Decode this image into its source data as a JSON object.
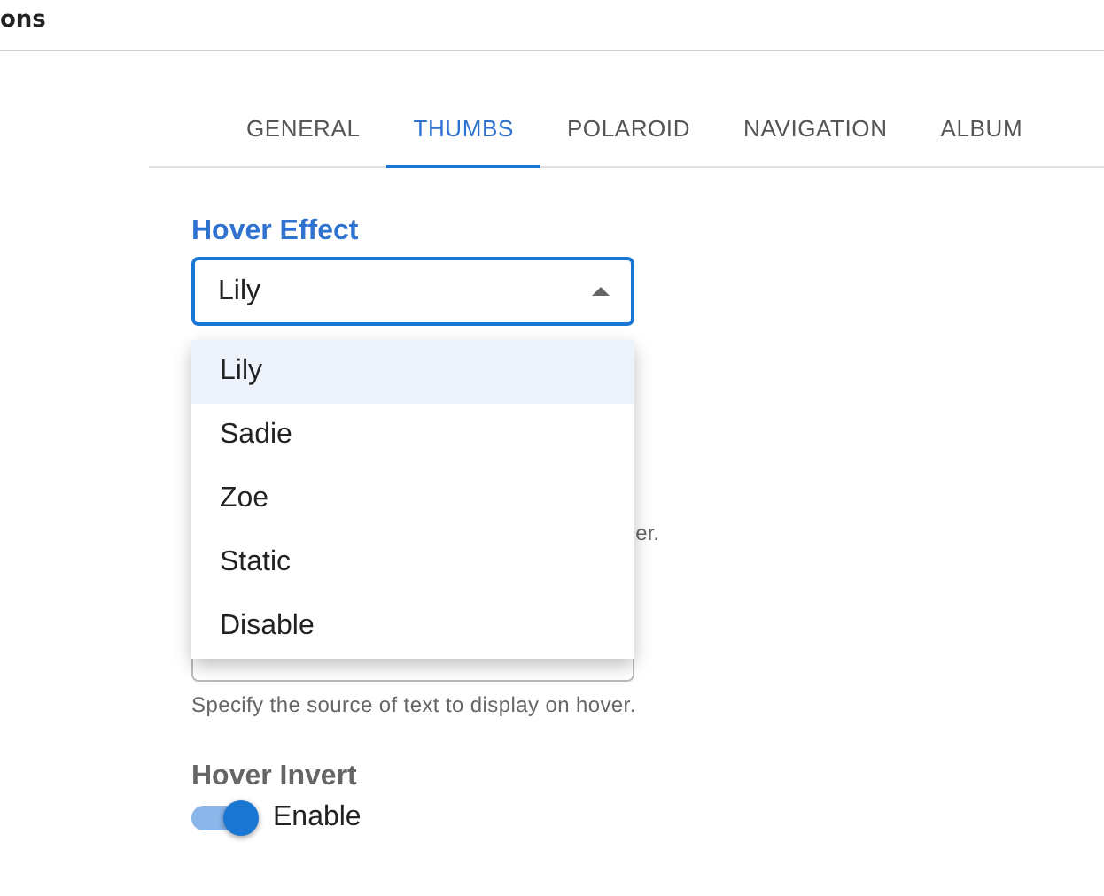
{
  "header": {
    "title": "ons"
  },
  "tabs": [
    {
      "label": "GENERAL",
      "selected": false
    },
    {
      "label": "THUMBS",
      "selected": true
    },
    {
      "label": "POLAROID",
      "selected": false
    },
    {
      "label": "NAVIGATION",
      "selected": false
    },
    {
      "label": "ALBUM",
      "selected": false
    }
  ],
  "hover_effect": {
    "label": "Hover Effect",
    "value": "Lily",
    "expanded": true,
    "options": [
      {
        "label": "Lily",
        "selected": true
      },
      {
        "label": "Sadie",
        "selected": false
      },
      {
        "label": "Zoe",
        "selected": false
      },
      {
        "label": "Static",
        "selected": false
      },
      {
        "label": "Disable",
        "selected": false
      }
    ],
    "help": "er."
  },
  "hover_text": {
    "help": "Specify the source of text to display on hover."
  },
  "hover_invert": {
    "label": "Hover Invert",
    "on": true,
    "switch_label": "Enable"
  }
}
